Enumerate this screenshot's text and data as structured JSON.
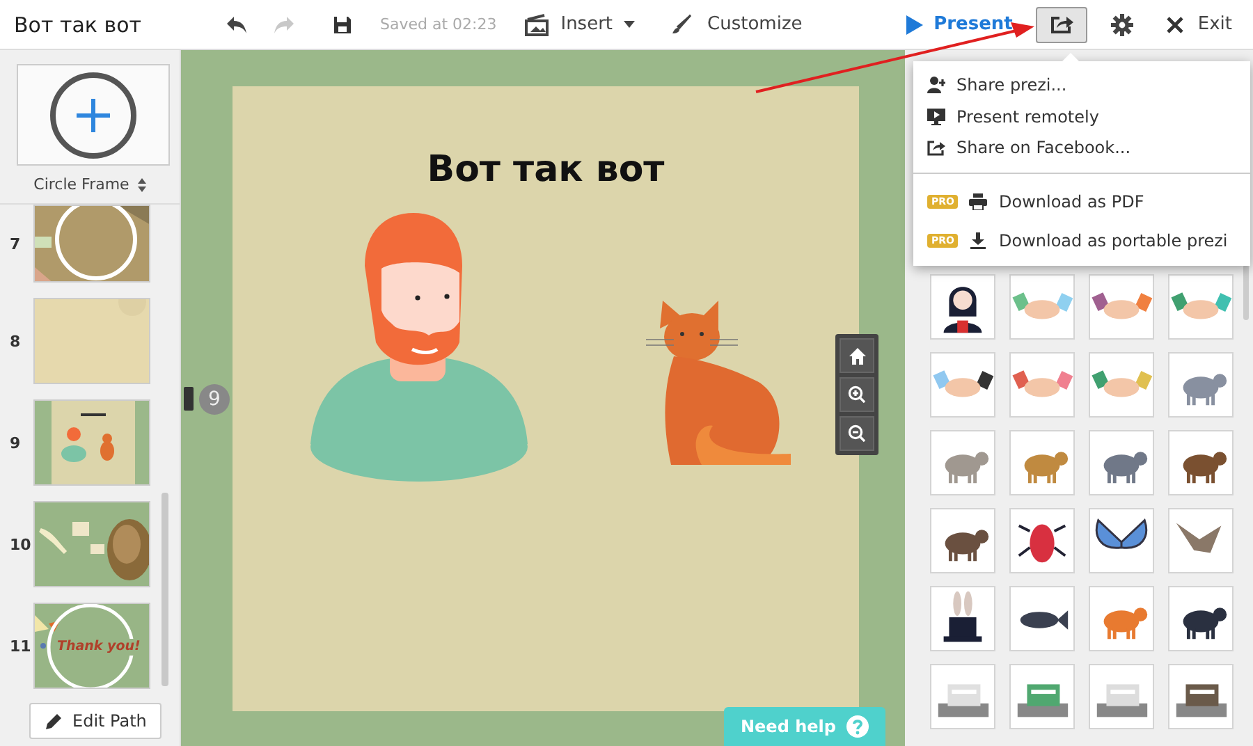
{
  "app_bar": {
    "title": "Вот так вот",
    "undo": {
      "disabled": false
    },
    "redo": {
      "disabled": true
    },
    "saved_status": "Saved at 02:23",
    "insert_label": "Insert",
    "customize_label": "Customize",
    "present_label": "Present",
    "share": {
      "selected": true
    },
    "exit_label": "Exit"
  },
  "sidebar": {
    "frame_picker": {
      "label": "Circle Frame"
    },
    "slides": [
      {
        "number": "7"
      },
      {
        "number": "8"
      },
      {
        "number": "9"
      },
      {
        "number": "10"
      },
      {
        "number": "11",
        "caption": "Thank you!"
      }
    ],
    "edit_path_label": "Edit Path"
  },
  "canvas": {
    "slide_title": "Вот так вот",
    "current_step": "9",
    "help_label": "Need help"
  },
  "share_menu": {
    "groups": [
      [
        {
          "label": "Share prezi..."
        },
        {
          "label": "Present remotely"
        },
        {
          "label": "Share on Facebook..."
        }
      ],
      [
        {
          "label": "Download as PDF",
          "badge": "PRO"
        },
        {
          "label": "Download as portable prezi",
          "badge": "PRO"
        }
      ]
    ]
  }
}
